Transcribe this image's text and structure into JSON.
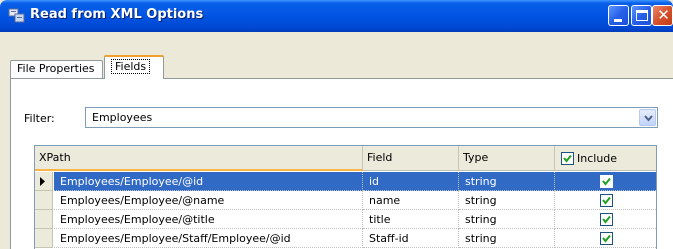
{
  "window": {
    "title": "Read from XML Options"
  },
  "tabs": [
    {
      "label": "File Properties"
    },
    {
      "label": "Fields"
    }
  ],
  "filter": {
    "label": "Filter:",
    "value": "Employees"
  },
  "grid": {
    "headers": {
      "xpath": "XPath",
      "field": "Field",
      "type": "Type",
      "include": "Include"
    },
    "header_include_checked": true,
    "rows": [
      {
        "xpath": "Employees/Employee/@id",
        "field": "id",
        "type": "string",
        "include": true,
        "selected": true
      },
      {
        "xpath": "Employees/Employee/@name",
        "field": "name",
        "type": "string",
        "include": true,
        "selected": false
      },
      {
        "xpath": "Employees/Employee/@title",
        "field": "title",
        "type": "string",
        "include": true,
        "selected": false
      },
      {
        "xpath": "Employees/Employee/Staff/Employee/@id",
        "field": "Staff-id",
        "type": "string",
        "include": true,
        "selected": false
      }
    ]
  },
  "colors": {
    "titlebar": "#0054e3",
    "selection": "#316ac5",
    "checkmark": "#21a121",
    "active_tab_accent": "#f0a030"
  }
}
